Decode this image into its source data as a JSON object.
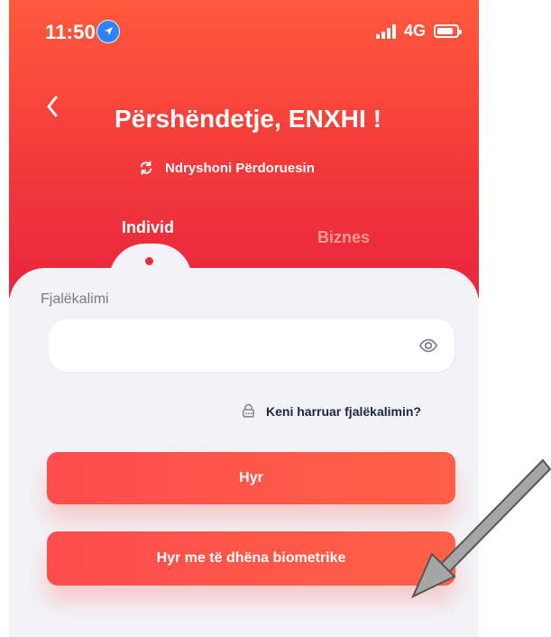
{
  "status_bar": {
    "time": "11:50",
    "network": "4G",
    "location_icon": "location-arrow-icon",
    "signal_icon": "cellular-signal-icon",
    "battery_icon": "battery-icon"
  },
  "header": {
    "back_icon": "chevron-left-icon",
    "greeting": "Përshëndetje, ENXHI !",
    "switch_user_label": "Ndryshoni Përdoruesin",
    "switch_user_icon": "refresh-icon"
  },
  "tabs": [
    {
      "label": "Individ",
      "active": true
    },
    {
      "label": "Biznes",
      "active": false
    }
  ],
  "password": {
    "label": "Fjalëkalimi",
    "value": "",
    "placeholder": "",
    "visibility_icon": "eye-icon"
  },
  "forgot_password": {
    "label": "Keni harruar fjalëkalimin?",
    "icon": "lock-icon"
  },
  "buttons": {
    "login": "Hyr",
    "biometric_login": "Hyr me të dhëna biometrike"
  },
  "annotation": {
    "icon": "pointer-arrow-icon"
  },
  "colors": {
    "brand_red": "#f43b3a",
    "button_red": "#ff4d4d",
    "text_dark": "#1d2447",
    "background": "#f3f3f7"
  }
}
